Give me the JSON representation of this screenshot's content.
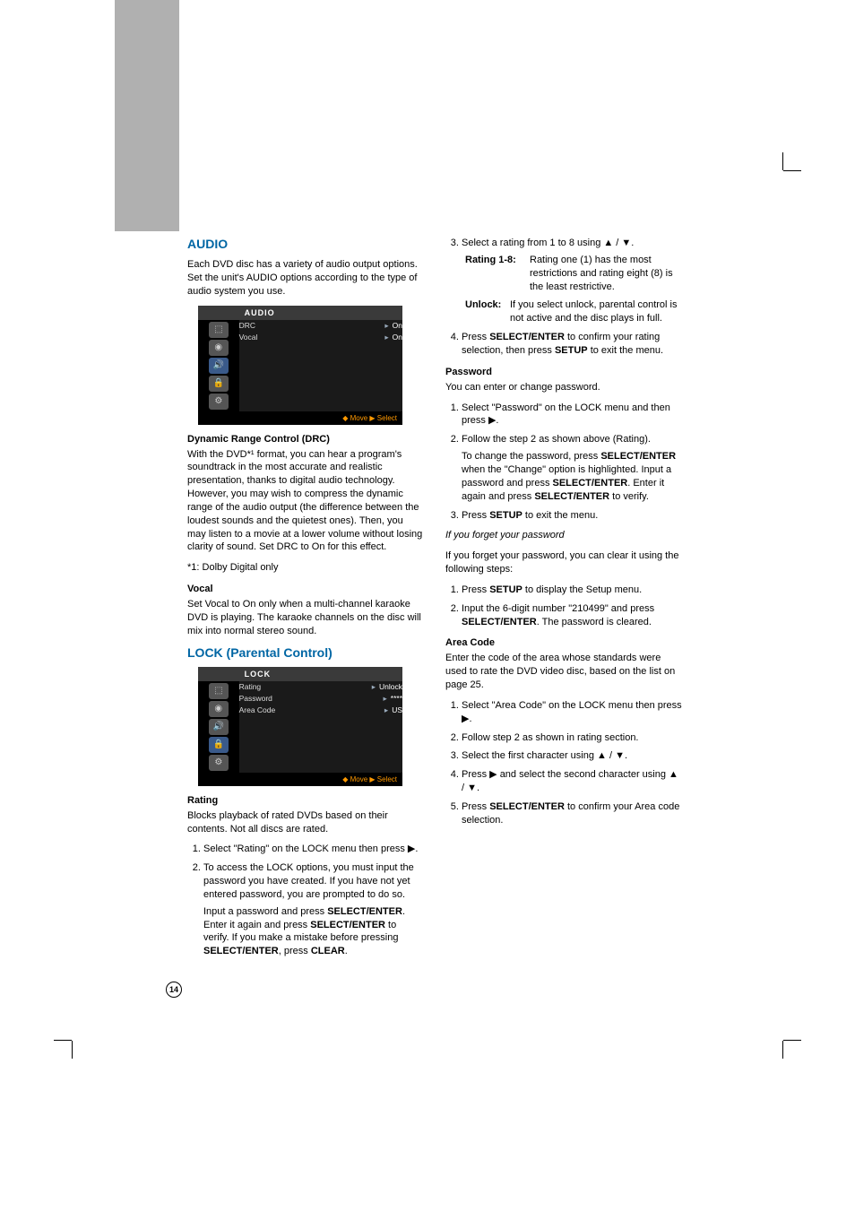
{
  "page_number": "14",
  "left": {
    "audio_heading": "AUDIO",
    "audio_intro": "Each DVD disc has a variety of audio output options. Set the unit's AUDIO options according to the type of audio system you use.",
    "osd_audio": {
      "title": "AUDIO",
      "rows": [
        {
          "label": "DRC",
          "value": "On"
        },
        {
          "label": "Vocal",
          "value": "On"
        }
      ],
      "footer": "◆ Move    ▶ Select"
    },
    "drc_heading": "Dynamic Range Control (DRC)",
    "drc_body": "With the DVD*¹ format, you can hear a program's soundtrack in the most accurate and realistic presentation, thanks to digital audio technology. However, you may wish to compress the dynamic range of the audio output (the difference between the loudest sounds and the quietest ones). Then, you may listen to a movie at a lower volume without losing clarity of sound. Set DRC to On for this effect.",
    "drc_note": "*1: Dolby Digital only",
    "vocal_heading": "Vocal",
    "vocal_body": "Set Vocal to On only when a multi-channel karaoke DVD is playing. The karaoke channels on the disc will mix into normal stereo sound.",
    "lock_heading": "LOCK (Parental Control)",
    "osd_lock": {
      "title": "LOCK",
      "rows": [
        {
          "label": "Rating",
          "value": "Unlock"
        },
        {
          "label": "Password",
          "value": "****"
        },
        {
          "label": "Area Code",
          "value": "US"
        }
      ],
      "footer": "◆ Move    ▶ Select"
    },
    "rating_heading": "Rating",
    "rating_intro": "Blocks playback of rated DVDs based on their contents. Not all discs are rated.",
    "rating_step1": "Select \"Rating\" on the LOCK menu then press ▶.",
    "rating_step2": "To access the LOCK options, you must input the password you have created. If you have not yet entered password, you are prompted to do so.",
    "rating_step2b_pre": "Input a password and press ",
    "rating_step2b_se1": "SELECT/ENTER",
    "rating_step2b_mid": ". Enter it again and press ",
    "rating_step2b_se2": "SELECT/ENTER",
    "rating_step2b_mid2": " to verify. If you make a mistake before pressing ",
    "rating_step2b_se3": "SELECT/ENTER",
    "rating_step2b_mid3": ", press ",
    "rating_step2b_clear": "CLEAR",
    "rating_step2b_end": "."
  },
  "right": {
    "step3": "Select a rating from 1 to 8 using ▲ / ▼.",
    "rating18_label": "Rating 1-8:",
    "rating18_body": " Rating one (1) has the most restrictions and rating eight (8) is the least restrictive.",
    "unlock_label": "Unlock:",
    "unlock_body": " If you select unlock, parental control is not active and the disc plays in full.",
    "step4_pre": "Press ",
    "step4_se": "SELECT/ENTER",
    "step4_mid": " to confirm your rating selection, then press ",
    "step4_setup": "SETUP",
    "step4_end": " to exit the menu.",
    "password_heading": "Password",
    "password_intro": "You can enter or change password.",
    "pw_step1": "Select \"Password\" on the LOCK menu and then press ▶.",
    "pw_step2": "Follow the step 2 as shown above (Rating).",
    "pw_step2b_pre": "To change the password, press ",
    "pw_step2b_se1": "SELECT/ENTER",
    "pw_step2b_mid1": " when the \"Change\" option is highlighted. Input a password and press ",
    "pw_step2b_se2": "SELECT/ENTER",
    "pw_step2b_mid2": ". Enter it again and press ",
    "pw_step2b_se3": "SELECT/ENTER",
    "pw_step2b_end": " to verify.",
    "pw_step3_pre": "Press ",
    "pw_step3_setup": "SETUP",
    "pw_step3_end": " to exit the menu.",
    "forgot_heading": "If you forget your password",
    "forgot_intro": "If you forget your password, you can clear it using the following steps:",
    "forgot_step1_pre": "Press ",
    "forgot_step1_setup": "SETUP",
    "forgot_step1_end": " to display the Setup menu.",
    "forgot_step2_pre": "Input the 6-digit number \"210499\" and press ",
    "forgot_step2_se": "SELECT/ENTER",
    "forgot_step2_end": ". The password is cleared.",
    "area_heading": "Area Code",
    "area_intro": "Enter the code of the area whose standards were used to rate the DVD video disc, based on the list on page 25.",
    "area_step1": "Select \"Area Code\" on the LOCK menu then press ▶.",
    "area_step2": "Follow step 2 as shown in rating section.",
    "area_step3": "Select the first character using ▲ / ▼.",
    "area_step4": "Press ▶ and select the second character using ▲ / ▼.",
    "area_step5_pre": "Press ",
    "area_step5_se": "SELECT/ENTER",
    "area_step5_end": " to confirm your Area code selection."
  }
}
